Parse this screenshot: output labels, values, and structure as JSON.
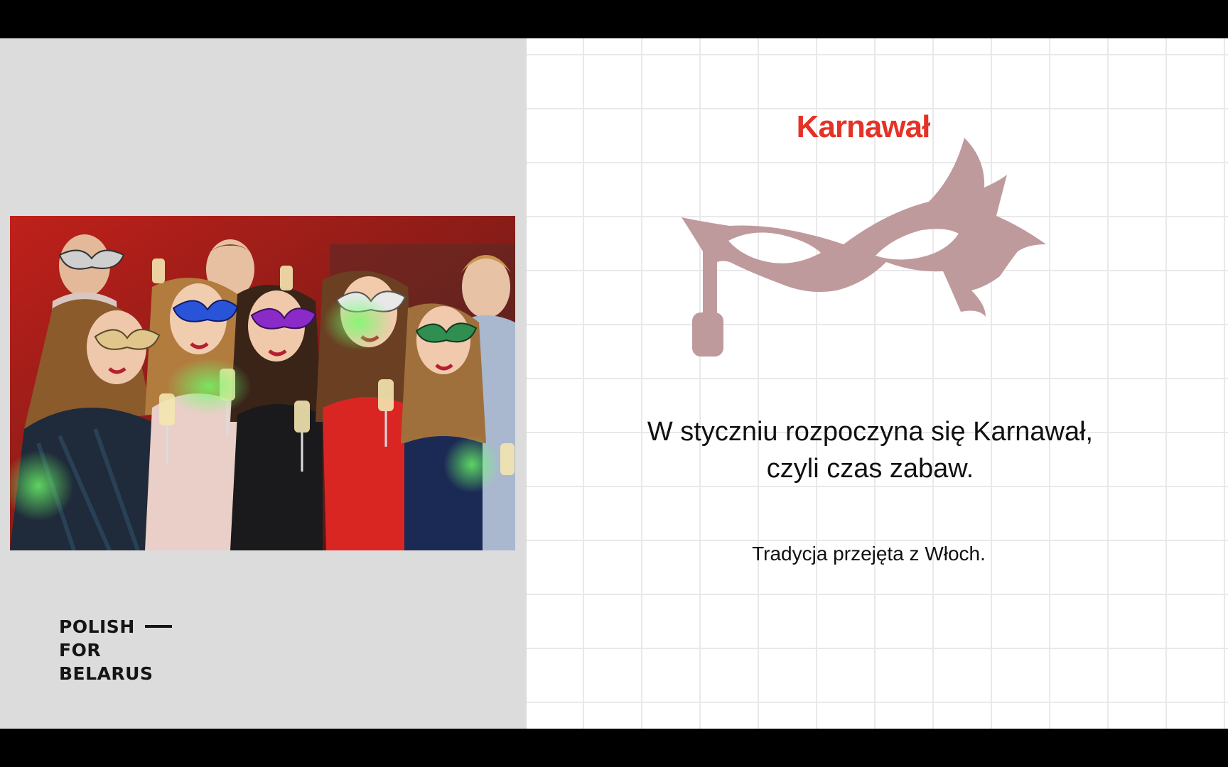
{
  "brand": {
    "line1": "POLISH",
    "line2": "FOR",
    "line3": "BELARUS"
  },
  "slide": {
    "title": "Karnawał",
    "main_line1": "W styczniu rozpoczyna się Karnawał,",
    "main_line2": "czyli czas zabaw.",
    "sub": "Tradycja przejęta z Włoch."
  },
  "colors": {
    "title": "#e43326",
    "mask": "#bf9a9d",
    "left_panel": "#dcdcdc",
    "grid": "#e9e9e9"
  },
  "icons": {
    "mask": "carnival-mask-icon"
  }
}
